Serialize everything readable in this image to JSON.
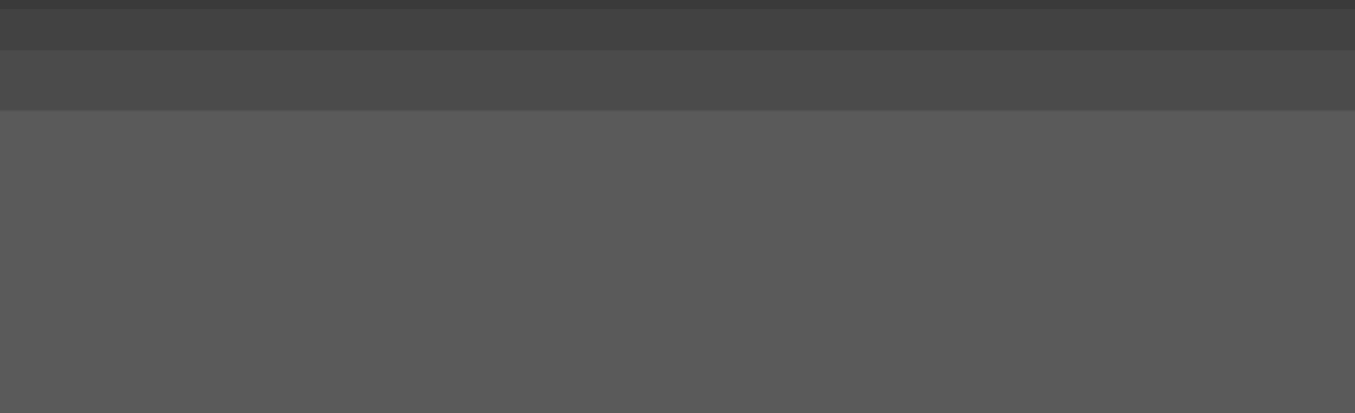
{
  "colors": {
    "top_edge": "#3a3a3a",
    "title_bar": "#424242",
    "toolbar": "#4b4b4b",
    "content": "#5a5a5a"
  },
  "window": {},
  "title_bar": {},
  "toolbar": {},
  "content": {}
}
